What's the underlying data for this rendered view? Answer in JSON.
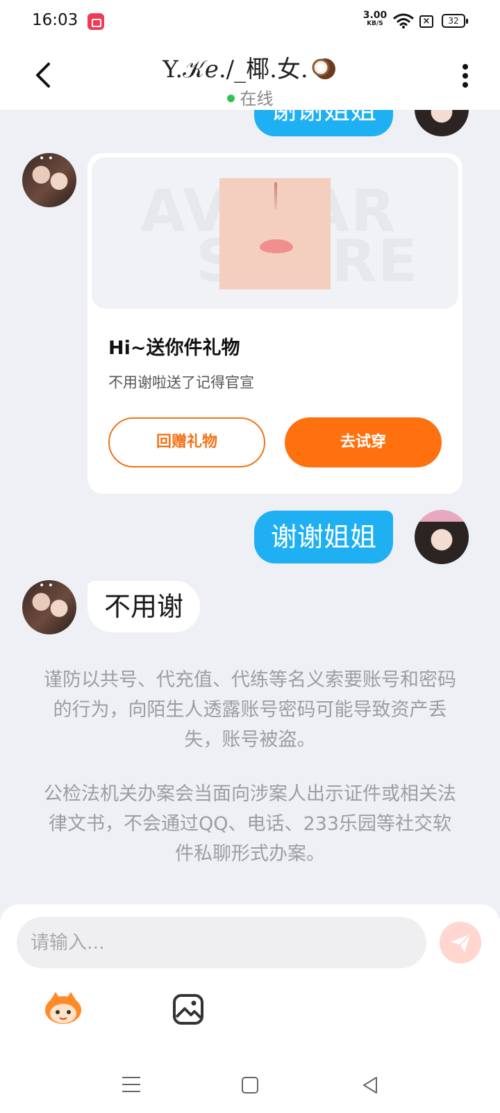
{
  "status_bar": {
    "time": "16:03",
    "net_speed": "3.00",
    "net_unit": "KB/S",
    "battery": "32"
  },
  "header": {
    "title": "Y.𝒦𝑒./_椰.女.",
    "status": "在线"
  },
  "messages": {
    "top_partial": "谢谢姐姐",
    "gift": {
      "title": "Hi~送你件礼物",
      "subtitle": "不用谢啦送了记得官宣",
      "watermark_1": "AVATAR",
      "watermark_2": "STORE",
      "return_gift_label": "回赠礼物",
      "try_on_label": "去试穿"
    },
    "reply_right": "谢谢姐姐",
    "reply_left": "不用谢"
  },
  "notices": {
    "warning_1": "谨防以共号、代充值、代练等名义索要账号和密码的行为，向陌生人透露账号密码可能导致资产丢失，账号被盗。",
    "warning_2": "公检法机关办案会当面向涉案人出示证件或相关法律文书，不会通过QQ、电话、233乐园等社交软件私聊形式办案。"
  },
  "input": {
    "placeholder": "请输入..."
  },
  "colors": {
    "accent_orange": "#ff700f",
    "bubble_blue": "#1fb0f3",
    "online_green": "#2ec455"
  },
  "icons": [
    "back-arrow-icon",
    "more-vertical-icon",
    "send-icon",
    "emoji-mascot-icon",
    "image-icon",
    "coconut-icon"
  ]
}
